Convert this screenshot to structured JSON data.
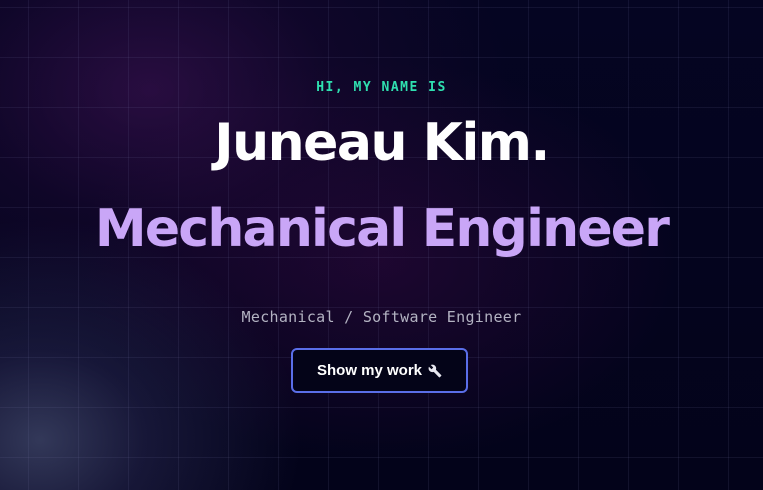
{
  "hero": {
    "greeting": "HI, MY NAME IS",
    "name": "Juneau Kim.",
    "role": "Mechanical Engineer",
    "subtitle": "Mechanical / Software Engineer",
    "cta_label": "Show my work",
    "cta_icon": "wrench-icon"
  },
  "colors": {
    "background": "#03041a",
    "greeting": "#2fe0b0",
    "name": "#ffffff",
    "role": "#c9a6f7",
    "subtitle": "#b3b3c2",
    "button_border": "#5a6ee8"
  }
}
